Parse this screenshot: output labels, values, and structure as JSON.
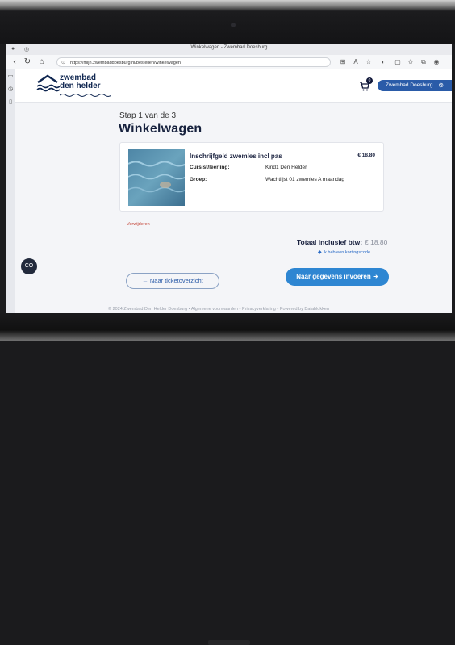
{
  "browser": {
    "window_title": "Winkelwagen - Zwembad Doesburg",
    "url": "https://mijn.zwembaddoesburg.nl/bestellen/winkelwagen",
    "nav": {
      "back_icon": "arrow-left-icon",
      "forward_icon": "arrow-right-icon",
      "reload_icon": "reload-icon",
      "home_icon": "home-icon"
    }
  },
  "site": {
    "logo": {
      "line1": "zwembad",
      "line2": "den helder"
    },
    "cart_count": "0",
    "user_label": "Zwembad Doesburg",
    "brand_color": "#2a5ba8",
    "accent_color": "#2e86d2"
  },
  "checkout": {
    "step": "Stap 1 van de 3",
    "title": "Winkelwagen",
    "item": {
      "name": "Inschrijfgeld zwemles incl pas",
      "price": "€ 18,80",
      "details": [
        {
          "label": "Cursist/leerling:",
          "value": "Kind1 Den Helder"
        },
        {
          "label": "Groep:",
          "value": "Wachtlijst 01 zwemles A maandag"
        }
      ]
    },
    "remove_label": "Verwijderen",
    "total_label": "Totaal inclusief btw:",
    "total_amount": "€ 18,80",
    "discount_label": "Ik heb een kortingscode",
    "back_label": "Naar ticketoverzicht",
    "next_label": "Naar gegevens invoeren"
  },
  "footer": {
    "text": "© 2024 Zwembad Den Helder Doesburg • Algemene voorwaarden • Privacyverklaring • Powered by Datablokken"
  },
  "chat_label": "CO"
}
